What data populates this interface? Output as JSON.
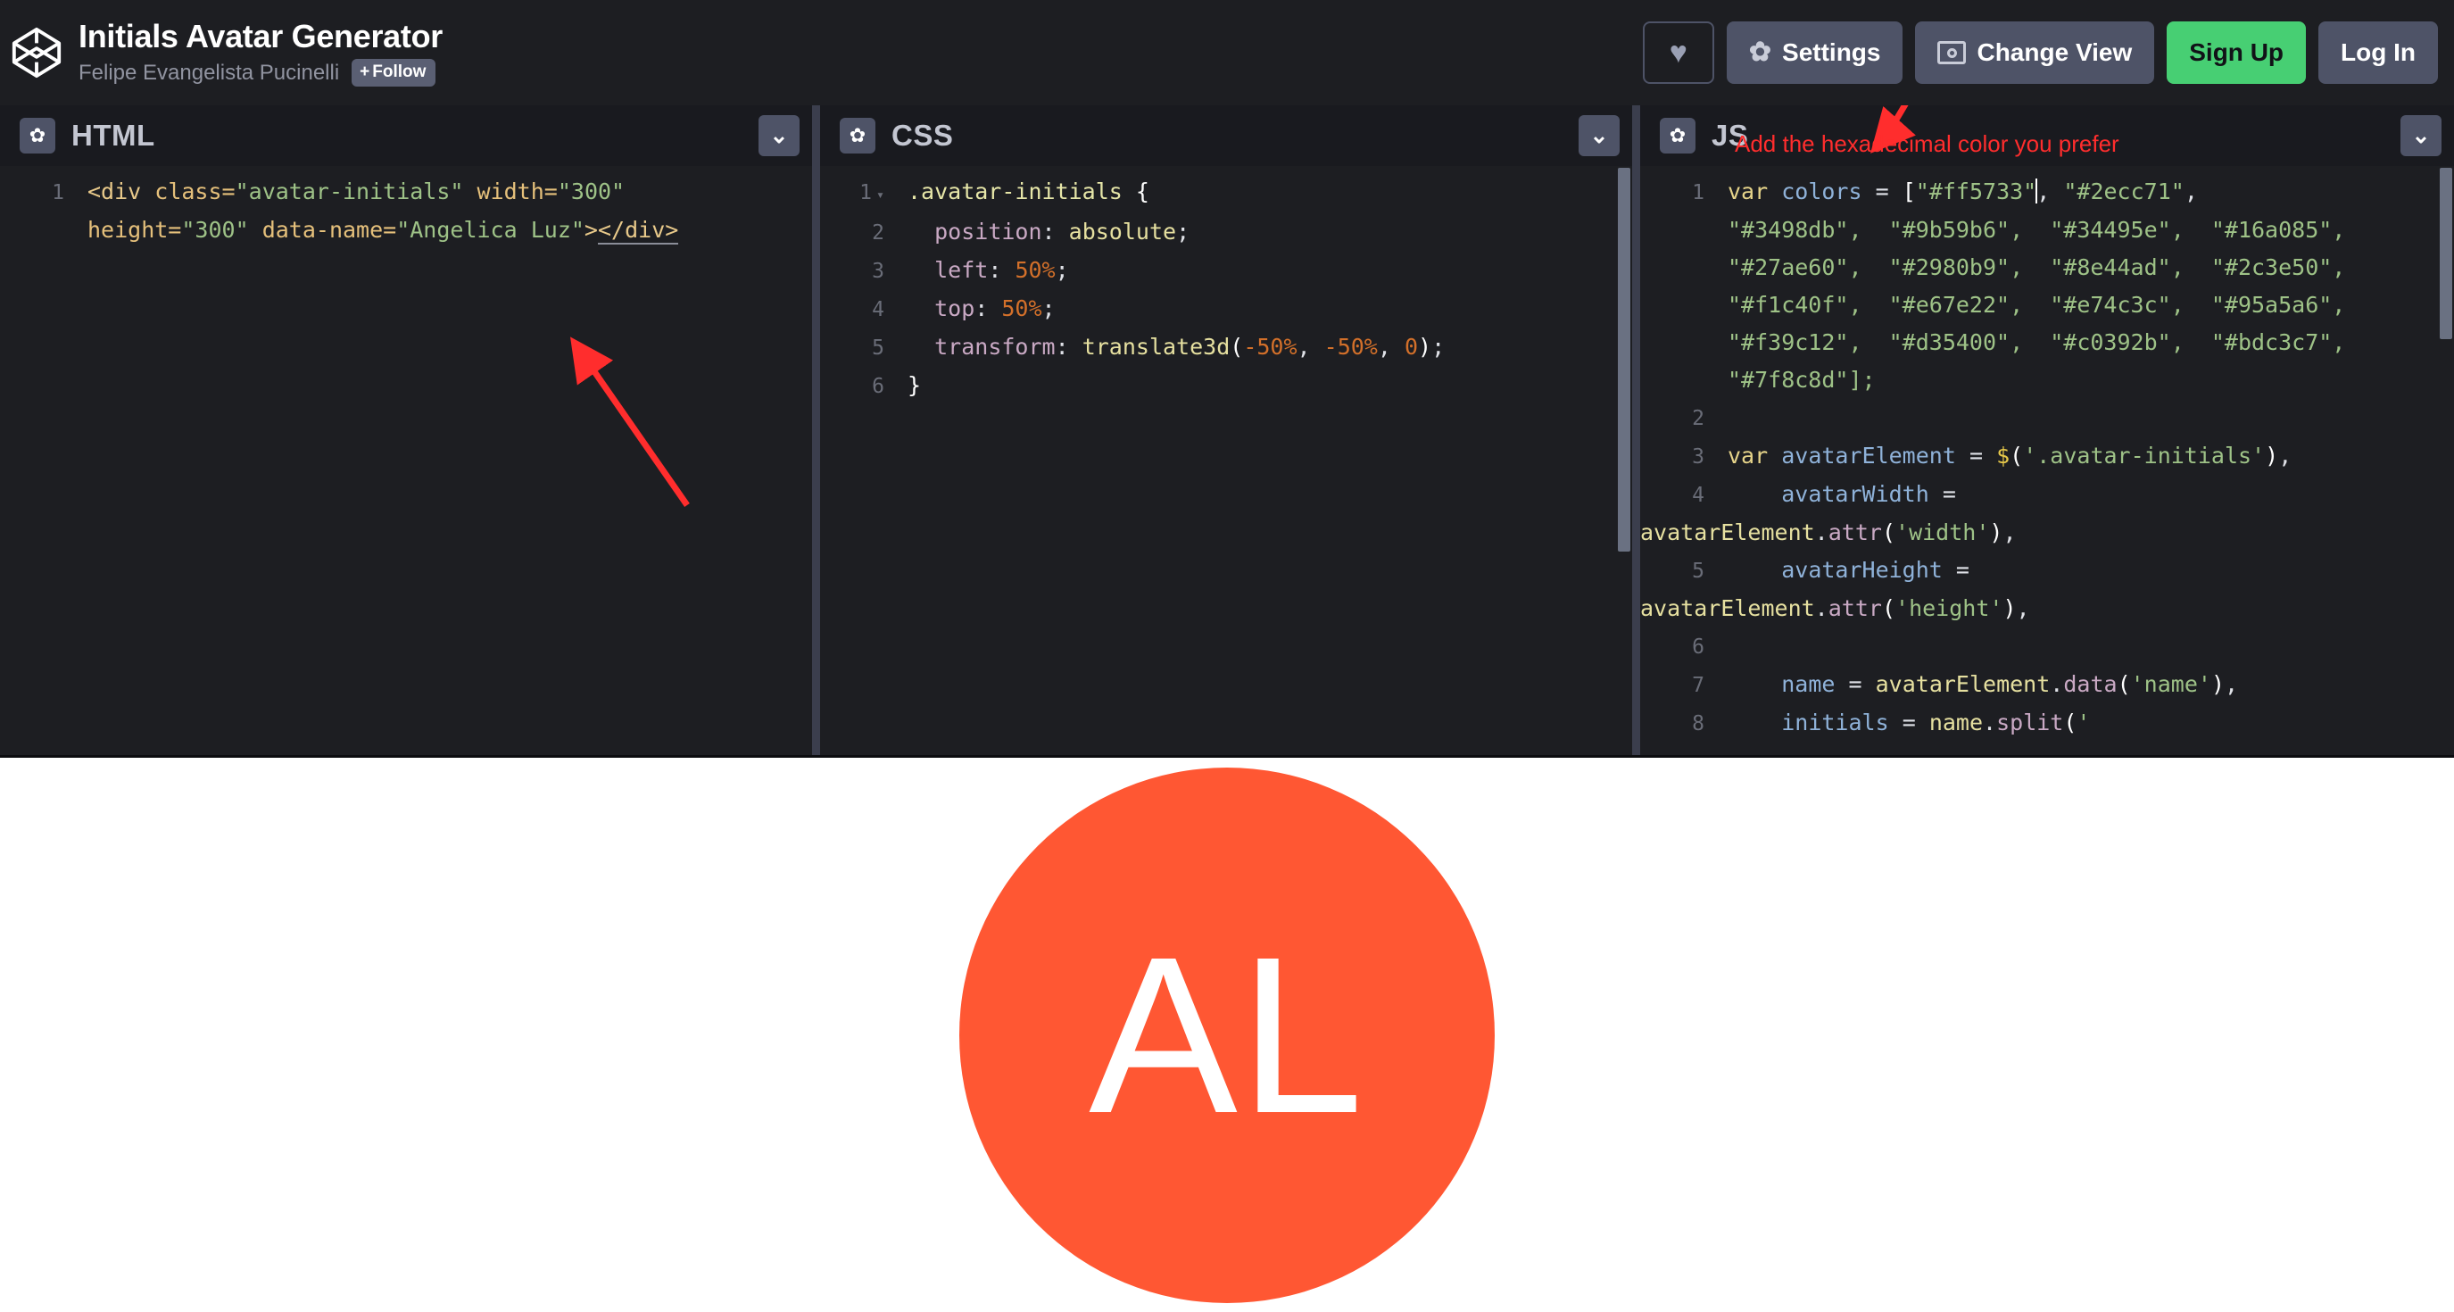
{
  "header": {
    "logo_icon": "codepen-logo-icon",
    "pen_title": "Initials Avatar Generator",
    "author": "Felipe Evangelista Pucinelli",
    "follow_plus": "+",
    "follow_label": "Follow",
    "heart_icon": "♥",
    "gear_icon": "✿",
    "settings_label": "Settings",
    "change_view_label": "Change View",
    "signup_label": "Sign Up",
    "login_label": "Log In",
    "signup_color": "#47cf73"
  },
  "panels": {
    "html": {
      "label": "HTML",
      "gear_icon": "✿",
      "chevron_icon": "⌄",
      "line_numbers": [
        "1"
      ],
      "code_line1_a": "<div",
      "code_line1_b": "class=",
      "code_line1_c": "\"avatar-initials\"",
      "code_line1_d": "width=",
      "code_line1_e": "\"300\"",
      "code_line2_a": "height=",
      "code_line2_b": "\"300\"",
      "code_line2_c": "data-name=",
      "code_line2_d": "\"Angelica Luz\"",
      "code_line2_e": ">",
      "code_line2_f": "</div>"
    },
    "css": {
      "label": "CSS",
      "gear_icon": "✿",
      "chevron_icon": "⌄",
      "line_numbers": [
        "1",
        "2",
        "3",
        "4",
        "5",
        "6"
      ],
      "l1_sel": ".avatar-initials",
      "l1_brace": "{",
      "l2_prop": "position",
      "l2_val": "absolute",
      "l3_prop": "left",
      "l3_val": "50%",
      "l4_prop": "top",
      "l4_val": "50%",
      "l5_prop": "transform",
      "l5_fn": "translate3d",
      "l5_a": "-50%",
      "l5_b": "-50%",
      "l5_c": "0",
      "l6_brace": "}"
    },
    "js": {
      "label": "JS",
      "gear_icon": "✿",
      "chevron_icon": "⌄",
      "line_numbers": [
        "1",
        "2",
        "3",
        "4",
        "5",
        "6",
        "7",
        "8"
      ],
      "kw_var": "var",
      "v_colors": "colors",
      "colors": [
        "\"#ff5733\"",
        "\"#2ecc71\"",
        "\"#3498db\"",
        "\"#9b59b6\"",
        "\"#34495e\"",
        "\"#16a085\"",
        "\"#27ae60\"",
        "\"#2980b9\"",
        "\"#8e44ad\"",
        "\"#2c3e50\"",
        "\"#f1c40f\"",
        "\"#e67e22\"",
        "\"#e74c3c\"",
        "\"#95a5a6\"",
        "\"#f39c12\"",
        "\"#d35400\"",
        "\"#c0392b\"",
        "\"#bdc3c7\"",
        "\"#7f8c8d\""
      ],
      "colors_row1": "\"#ff5733\"",
      "colors_row1b": "\"#2ecc71\"",
      "colors_row2": "\"#3498db\",  \"#9b59b6\",  \"#34495e\",  \"#16a085\",",
      "colors_row3": "\"#27ae60\",  \"#2980b9\",  \"#8e44ad\",  \"#2c3e50\",",
      "colors_row4": "\"#f1c40f\",  \"#e67e22\",  \"#e74c3c\",  \"#95a5a6\",",
      "colors_row5": "\"#f39c12\",  \"#d35400\",  \"#c0392b\",  \"#bdc3c7\",",
      "colors_row6": "\"#7f8c8d\"];",
      "l3_var": "avatarElement",
      "l3_sel": "'.avatar-initials'",
      "l4_var": "avatarWidth",
      "l4_obj": "avatarElement",
      "l4_meth": "attr",
      "l4_arg": "'width'",
      "l5_var": "avatarHeight",
      "l5_obj": "avatarElement",
      "l5_meth": "attr",
      "l5_arg": "'height'",
      "l7_var": "name",
      "l7_obj": "avatarElement",
      "l7_meth": "data",
      "l7_arg": "'name'",
      "l8_var": "initials",
      "l8_obj": "name",
      "l8_meth": "split",
      "l8_arg": "'"
    }
  },
  "annotations": {
    "js_note": "Add the hexadecimal color you prefer",
    "annotation_color": "#ff2d2d"
  },
  "preview": {
    "avatar_initials": "AL",
    "avatar_color": "#ff5733",
    "avatar_text_color": "#ffffff",
    "background": "#ffffff"
  }
}
